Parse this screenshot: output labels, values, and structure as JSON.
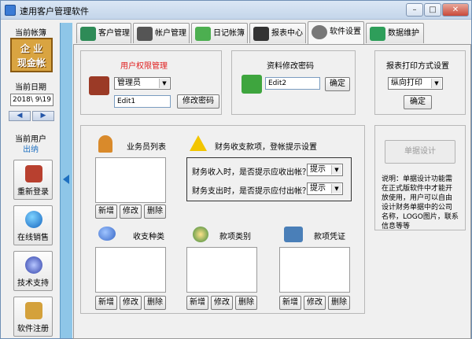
{
  "window": {
    "title": "速用客户管理软件",
    "minimize": "–",
    "maximize": "□",
    "close": "✕"
  },
  "sidebar": {
    "account_label": "当前帐簿",
    "logo_text": "企 业\n现金帐",
    "date_label": "当前日期",
    "date_value": "2018\\ 9\\19",
    "prev": "◀",
    "next": "▶",
    "user_label": "当前用户",
    "user_value": "出纳",
    "buttons": [
      {
        "label": "重新登录",
        "icon": "lock-icon"
      },
      {
        "label": "在线销售",
        "icon": "globe-icon"
      },
      {
        "label": "技术支持",
        "icon": "support-icon"
      },
      {
        "label": "软件注册",
        "icon": "key-icon"
      }
    ]
  },
  "tabs": [
    {
      "label": "客户管理",
      "icon": "pencil-icon",
      "active": false
    },
    {
      "label": "帐户管理",
      "icon": "lighthouse-icon",
      "active": false
    },
    {
      "label": "日记帐簿",
      "icon": "notebook-icon",
      "active": false
    },
    {
      "label": "报表中心",
      "icon": "film-icon",
      "active": false
    },
    {
      "label": "软件设置",
      "icon": "gear-icon",
      "active": true
    },
    {
      "label": "数据维护",
      "icon": "database-icon",
      "active": false
    }
  ],
  "permissions": {
    "title": "用户权限管理",
    "role_value": "管理员",
    "edit_value": "Edit1",
    "button": "修改密码"
  },
  "profile": {
    "title": "资料修改密码",
    "edit_value": "Edit2",
    "button": "确定"
  },
  "print": {
    "title": "报表打印方式设置",
    "mode_value": "纵向打印",
    "button": "确定"
  },
  "staff": {
    "title": "业务员列表",
    "add": "新增",
    "edit": "修改",
    "delete": "删除"
  },
  "finance_alert": {
    "title": "财务收支款项，登帐提示设置",
    "income_label": "财务收入时，是否提示应收出帐？",
    "income_value": "提示",
    "expense_label": "财务支出时，是否提示应付出帐？",
    "expense_value": "提示"
  },
  "category": {
    "title": "收支种类",
    "add": "新增",
    "edit": "修改",
    "delete": "删除"
  },
  "item_type": {
    "title": "款项类别",
    "add": "新增",
    "edit": "修改",
    "delete": "删除"
  },
  "voucher": {
    "title": "款项凭证",
    "add": "新增",
    "edit": "修改",
    "delete": "删除"
  },
  "doc_design": {
    "button": "单据设计",
    "note": "说明：单据设计功能需在正式版软件中才能开放使用，用户可以自由设计财务单据中的公司名称，LOGO图片，联系信息等等"
  },
  "colors": {
    "accent": "#1e6fc0",
    "title_red": "#e02020",
    "handle": "#8ec6e8"
  }
}
